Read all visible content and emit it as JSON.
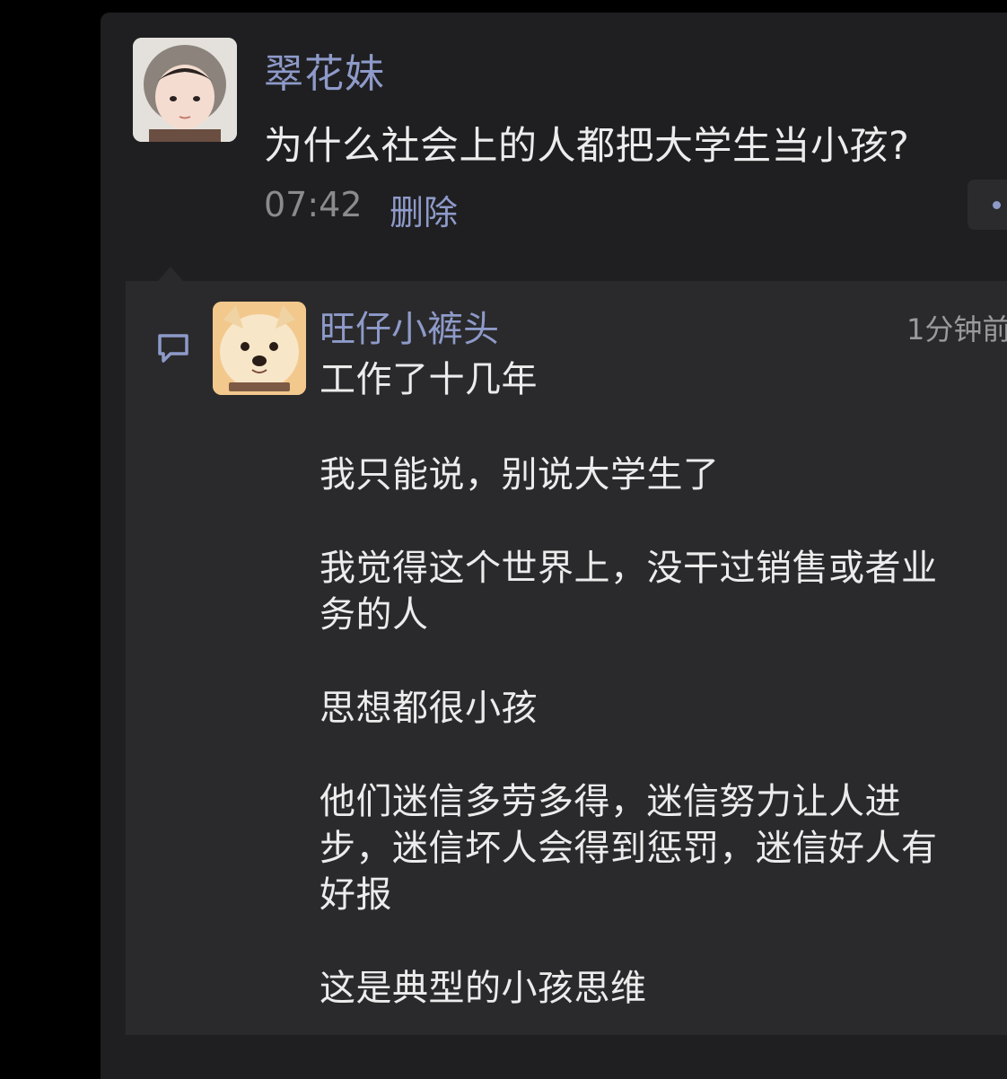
{
  "post": {
    "author": "翠花妹",
    "text": "为什么社会上的人都把大学生当小孩?",
    "time": "07:42",
    "delete_label": "删除",
    "avatar_icon": "toddler-avatar-icon"
  },
  "comment": {
    "author": "旺仔小裤头",
    "time": "1分钟前",
    "avatar_icon": "samoyed-dog-avatar-icon",
    "lines": [
      "工作了十几年",
      "我只能说，别说大学生了",
      "我觉得这个世界上，没干过销售或者业",
      "务的人",
      "思想都很小孩",
      "他们迷信多劳多得，迷信努力让人进",
      "步，迷信坏人会得到惩罚，迷信好人有",
      "好报",
      "这是典型的小孩思维"
    ]
  },
  "colors": {
    "accent": "#8e9ac9",
    "background": "#1f1f21",
    "comment_background": "#2a2a2c",
    "text": "#ececec",
    "muted": "#8b8b8d"
  }
}
